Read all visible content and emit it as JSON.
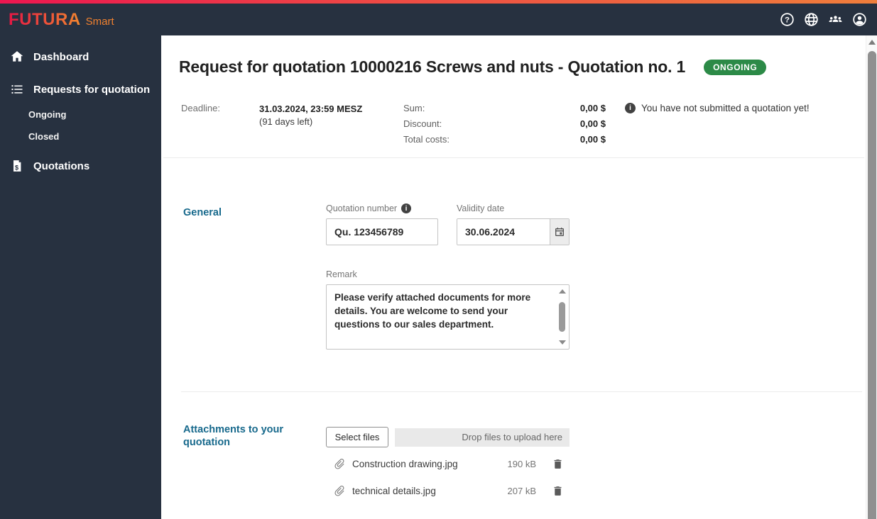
{
  "colors": {
    "header_bg": "#273140",
    "accent_heading": "#17698c",
    "badge_green": "#2c8a47",
    "top_gradient_start": "#ec1650",
    "top_gradient_end": "#ef7e3b"
  },
  "glyphs": {
    "help": "?",
    "info": "i",
    "dollar": "$"
  },
  "header": {
    "logo_primary": "FUTURA",
    "logo_secondary": "Smart",
    "icons": [
      "help-icon",
      "globe-icon",
      "users-icon",
      "account-icon"
    ]
  },
  "sidebar": {
    "items": [
      {
        "label": "Dashboard",
        "icon": "home"
      },
      {
        "label": "Requests for quotation",
        "icon": "list"
      },
      {
        "label": "Ongoing",
        "sub": true
      },
      {
        "label": "Closed",
        "sub": true
      },
      {
        "label": "Quotations",
        "icon": "receipt-dollar"
      }
    ]
  },
  "main": {
    "title": "Request for quotation 10000216 Screws and nuts - Quotation no. 1",
    "status_badge": "ONGOING",
    "summary": {
      "deadline_label": "Deadline:",
      "deadline_value": "31.03.2024, 23:59 MESZ",
      "deadline_note": "(91 days left)",
      "rows": [
        {
          "label": "Sum:",
          "value": "0,00 $"
        },
        {
          "label": "Discount:",
          "value": "0,00 $"
        },
        {
          "label": "Total costs:",
          "value": "0,00 $"
        }
      ],
      "notice": "You have not submitted a quotation yet!"
    },
    "general": {
      "heading": "General",
      "quotation_number_label": "Quotation number",
      "quotation_number_value": "Qu. 123456789",
      "validity_date_label": "Validity date",
      "validity_date_value": "30.06.2024",
      "remark_label": "Remark",
      "remark_value": "Please verify attached documents for more details. You are welcome to send your questions to our sales department."
    },
    "attachments": {
      "heading": "Attachments to your quotation",
      "select_files_label": "Select files",
      "dropzone_label": "Drop files to upload here",
      "files": [
        {
          "name": "Construction drawing.jpg",
          "size": "190 kB"
        },
        {
          "name": "technical details.jpg",
          "size": "207 kB"
        }
      ]
    }
  }
}
